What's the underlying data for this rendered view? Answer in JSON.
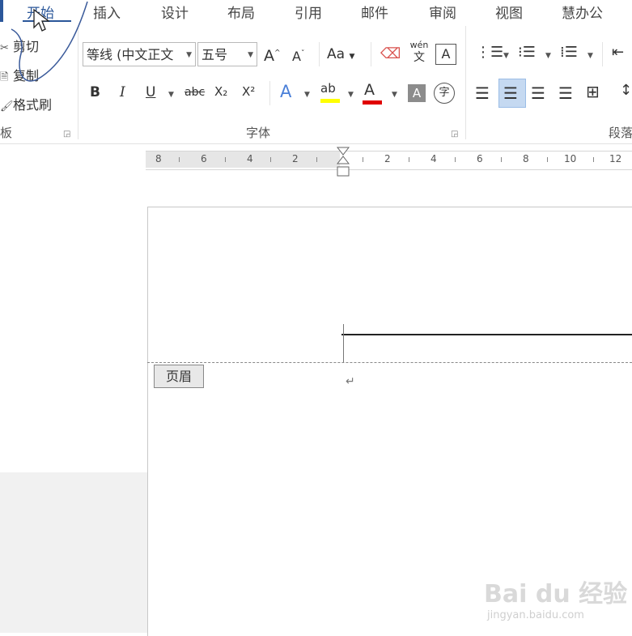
{
  "tabs": [
    {
      "label": "开始",
      "active": true
    },
    {
      "label": "插入"
    },
    {
      "label": "设计"
    },
    {
      "label": "布局"
    },
    {
      "label": "引用"
    },
    {
      "label": "邮件"
    },
    {
      "label": "审阅"
    },
    {
      "label": "视图"
    },
    {
      "label": "慧办公"
    }
  ],
  "clipboard": {
    "cut": "剪切",
    "copy": "复制",
    "format_painter": "格式刷",
    "group_label": "板"
  },
  "font": {
    "font_name": "等线 (中文正文",
    "font_size": "五号",
    "grow": "A",
    "shrink": "A",
    "change_case": "Aa",
    "phonetic_top": "wén",
    "phonetic_bottom": "文",
    "char_border": "A",
    "bold": "B",
    "italic": "I",
    "underline": "U",
    "strikethrough": "abc",
    "subscript": "X₂",
    "superscript": "X²",
    "text_effect": "A",
    "highlight": "ab",
    "font_color": "A",
    "shading": "A",
    "enclose": "字",
    "group_label": "字体"
  },
  "paragraph": {
    "group_label": "段落"
  },
  "ruler": {
    "numbers": [
      "8",
      "6",
      "4",
      "2",
      "2",
      "4",
      "6",
      "8",
      "10",
      "12"
    ]
  },
  "document": {
    "header_tag": "页眉",
    "paragraph_mark": "↵"
  },
  "watermark": {
    "brand": "Bai du 经验",
    "url": "jingyan.baidu.com"
  },
  "colors": {
    "accent": "#2b579a",
    "highlight_yellow": "#ffff00",
    "font_red": "#e00000",
    "selected_button": "#c5d9f1"
  }
}
